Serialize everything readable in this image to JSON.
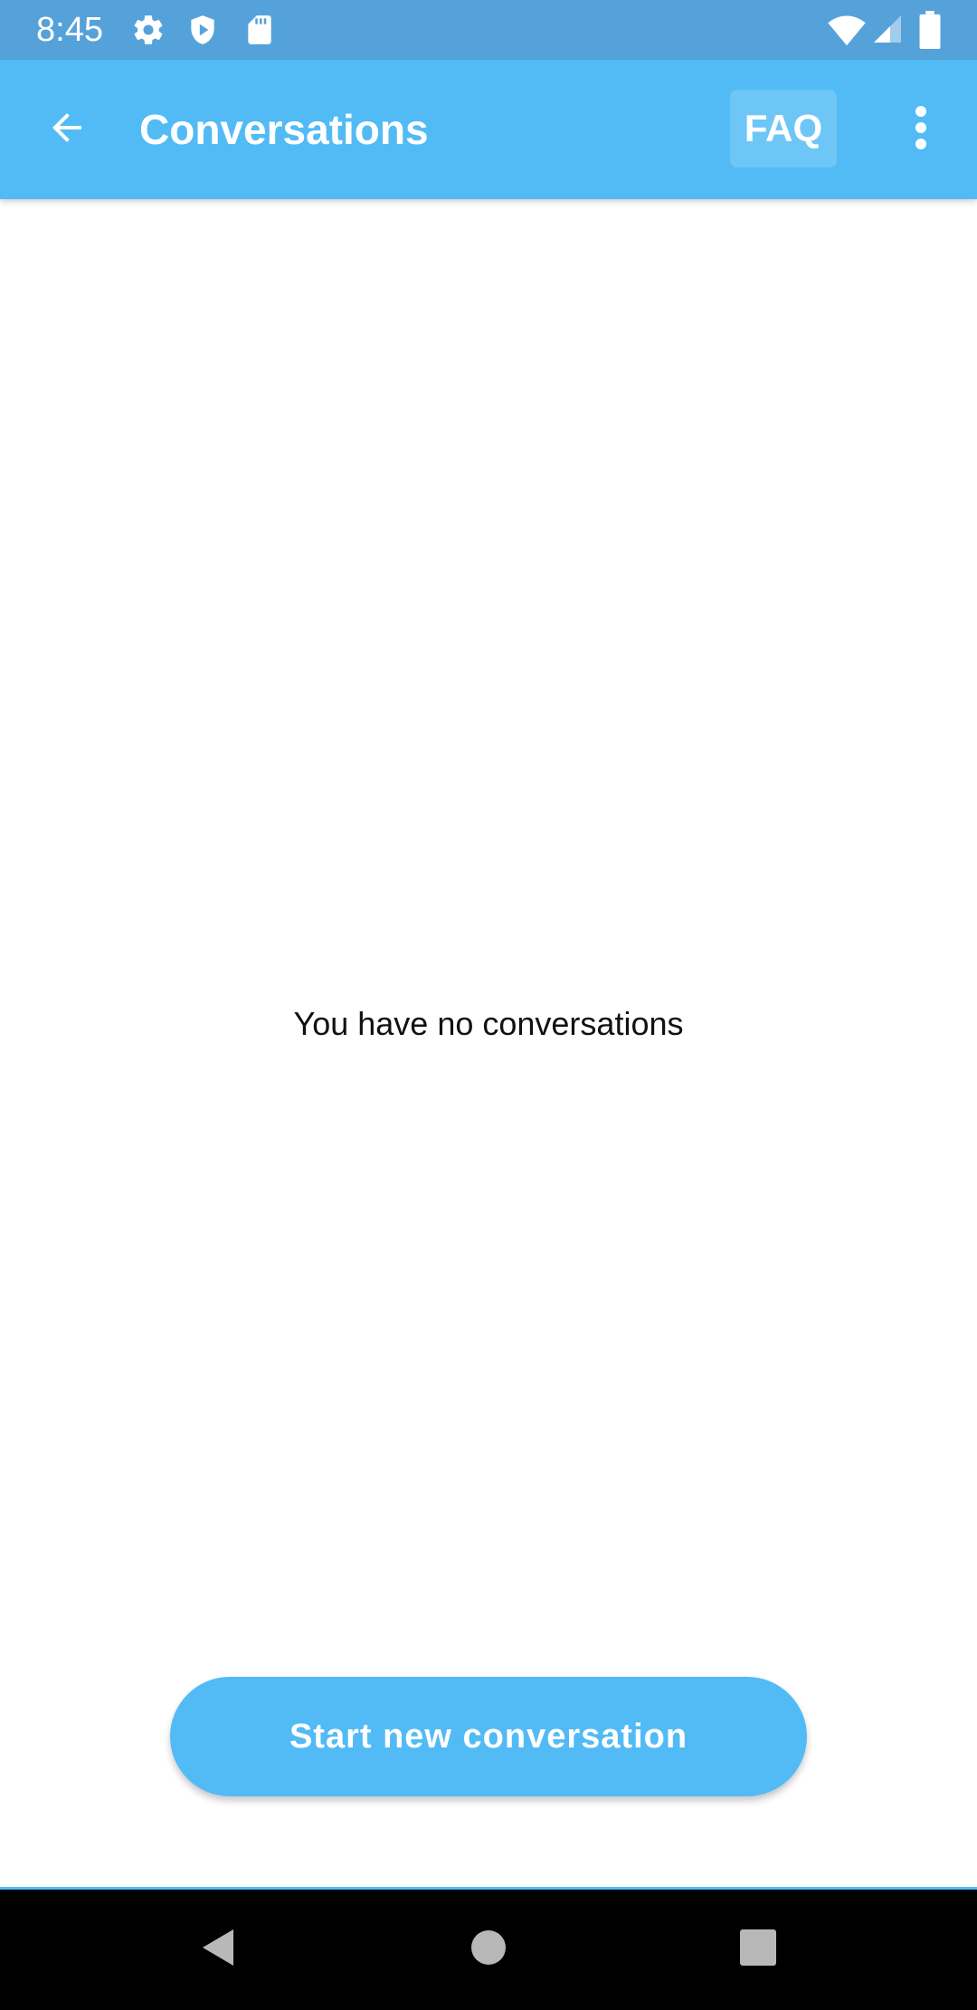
{
  "status_bar": {
    "time": "8:45",
    "icons": [
      "gear-icon",
      "shield-play-icon",
      "sd-card-icon",
      "wifi-icon",
      "signal-icon",
      "battery-icon"
    ]
  },
  "app_bar": {
    "back_icon": "arrow-back-icon",
    "title": "Conversations",
    "faq_label": "FAQ",
    "more_icon": "more-vert-icon"
  },
  "empty_state": {
    "message": "You have no conversations"
  },
  "actions": {
    "start_label": "Start new conversation"
  },
  "nav_bar": {
    "icons": [
      "nav-back-icon",
      "nav-home-icon",
      "nav-recents-icon"
    ]
  },
  "colors": {
    "status_bar": "#55a2da",
    "accent": "#52bbf5",
    "faq_bg": "#6ec6f7",
    "nav_bar": "#000000"
  }
}
